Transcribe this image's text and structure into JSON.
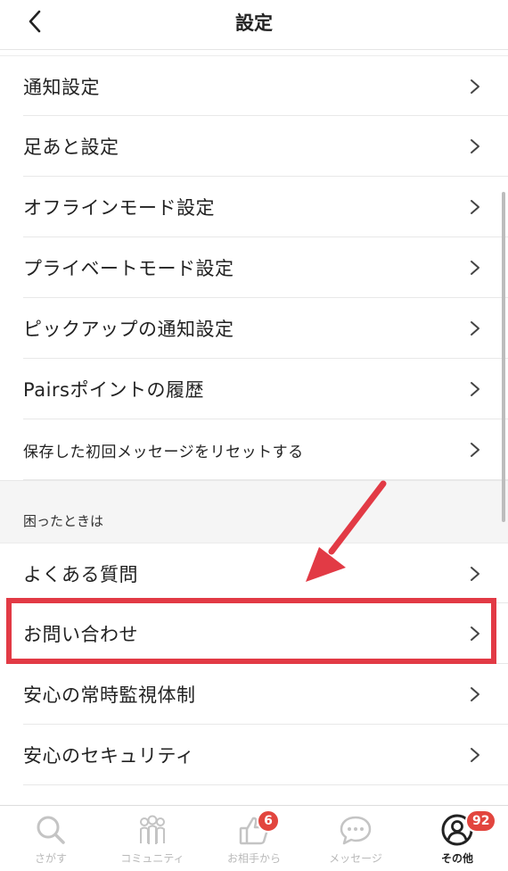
{
  "header": {
    "title": "設定",
    "back_icon": "chevron-left-icon"
  },
  "settings_items": [
    {
      "label": "通知設定"
    },
    {
      "label": "足あと設定"
    },
    {
      "label": "オフラインモード設定"
    },
    {
      "label": "プライベートモード設定"
    },
    {
      "label": "ピックアップの通知設定"
    },
    {
      "label": "Pairsポイントの履歴"
    },
    {
      "label": "保存した初回メッセージをリセットする"
    }
  ],
  "help_section": {
    "title": "困ったときは",
    "items": [
      {
        "label": "よくある質問"
      },
      {
        "label": "お問い合わせ"
      },
      {
        "label": "安心の常時監視体制"
      },
      {
        "label": "安心のセキュリティ"
      }
    ]
  },
  "annotation": {
    "color": "#e23a45"
  },
  "tabbar": {
    "tabs": [
      {
        "label": "さがす",
        "icon": "search-icon"
      },
      {
        "label": "コミュニティ",
        "icon": "community-icon"
      },
      {
        "label": "お相手から",
        "icon": "thumbs-up-icon",
        "badge": "6"
      },
      {
        "label": "メッセージ",
        "icon": "chat-bubble-icon"
      },
      {
        "label": "その他",
        "icon": "user-circle-icon",
        "badge": "92"
      }
    ]
  }
}
